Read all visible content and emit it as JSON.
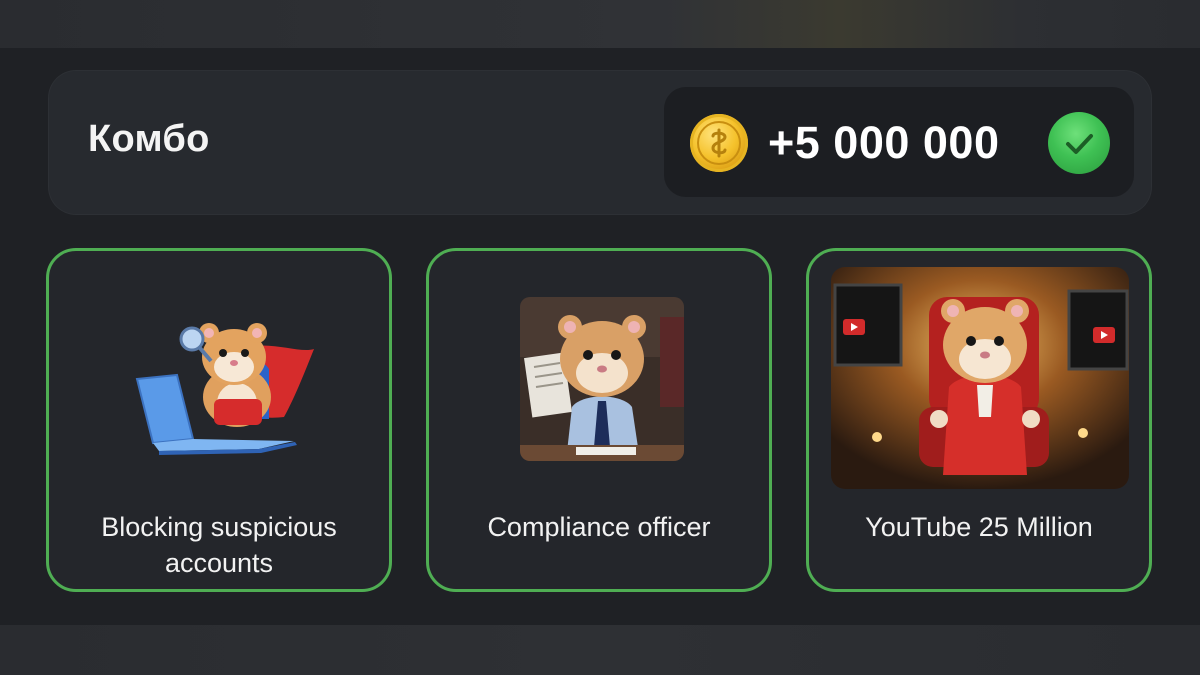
{
  "combo": {
    "title": "Комбо",
    "reward_amount": "+5 000 000",
    "coin_icon": "coin-icon",
    "status_icon": "check-circle-icon"
  },
  "cards": [
    {
      "label": "Blocking suspicious accounts",
      "image": "hamster-superhero-laptop-image"
    },
    {
      "label": "Compliance officer",
      "image": "hamster-office-suit-image"
    },
    {
      "label": "YouTube 25 Million",
      "image": "hamster-red-chair-youtube-image"
    }
  ],
  "colors": {
    "card_border": "#4fae53",
    "check_green": "#3fc154",
    "coin_gold": "#f5c22c",
    "background": "#1f2125"
  }
}
